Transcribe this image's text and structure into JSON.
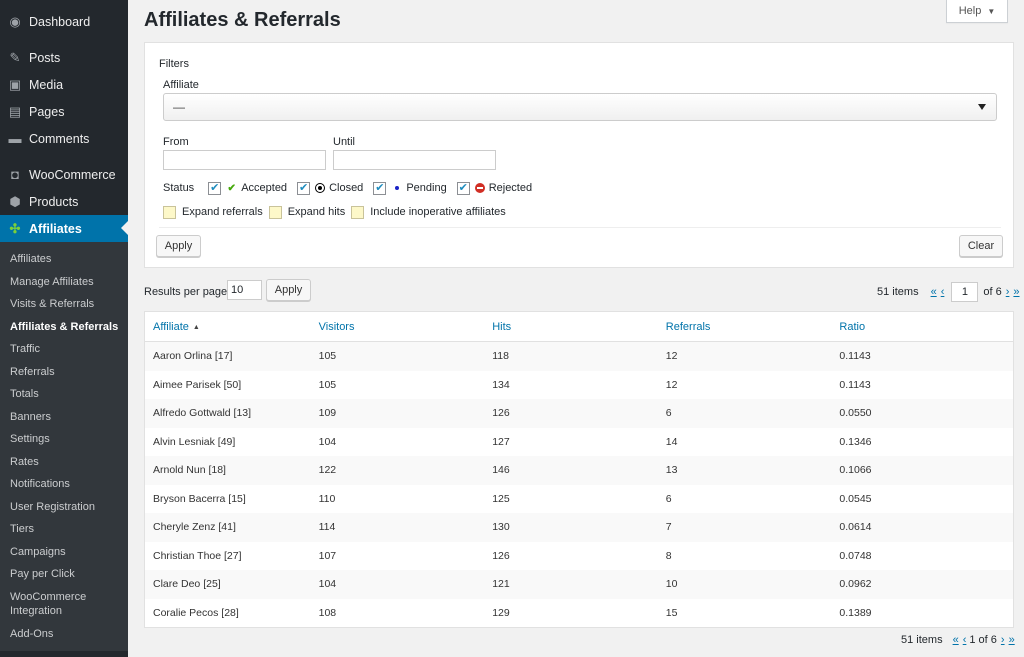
{
  "sidebar": {
    "top_items": [
      {
        "label": "Dashboard",
        "icon": "dashboard-icon"
      },
      {
        "label": "Posts",
        "icon": "pin-icon"
      },
      {
        "label": "Media",
        "icon": "media-icon"
      },
      {
        "label": "Pages",
        "icon": "pages-icon"
      },
      {
        "label": "Comments",
        "icon": "comment-icon"
      },
      {
        "label": "WooCommerce",
        "icon": "woo-icon"
      },
      {
        "label": "Products",
        "icon": "box-icon"
      },
      {
        "label": "Affiliates",
        "icon": "affiliates-icon"
      }
    ],
    "sub_items": [
      "Affiliates",
      "Manage Affiliates",
      "Visits & Referrals",
      "Affiliates & Referrals",
      "Traffic",
      "Referrals",
      "Totals",
      "Banners",
      "Settings",
      "Rates",
      "Notifications",
      "User Registration",
      "Tiers",
      "Campaigns",
      "Pay per Click",
      "WooCommerce Integration",
      "Add-Ons"
    ]
  },
  "header": {
    "title": "Affiliates & Referrals",
    "help_label": "Help",
    "help_arrow": "▼"
  },
  "filters": {
    "title": "Filters",
    "affiliate_label": "Affiliate",
    "affiliate_value": "—",
    "from_label": "From",
    "until_label": "Until",
    "from_value": "",
    "until_value": "",
    "status_label": "Status",
    "statuses": [
      {
        "label": "Accepted",
        "checked": true,
        "icon": "check-icon"
      },
      {
        "label": "Closed",
        "checked": true,
        "icon": "closed-icon"
      },
      {
        "label": "Pending",
        "checked": true,
        "icon": "pending-icon"
      },
      {
        "label": "Rejected",
        "checked": true,
        "icon": "rejected-icon"
      }
    ],
    "options": [
      "Expand referrals",
      "Expand hits",
      "Include inoperative affiliates"
    ],
    "apply_label": "Apply",
    "clear_label": "Clear"
  },
  "results": {
    "per_page_label": "Results per page",
    "per_page_value": "10",
    "apply_label": "Apply",
    "items_label": "51 items",
    "first": "«",
    "prev": "‹",
    "next": "›",
    "last": "»",
    "current_page": "1",
    "of_pages": "of 6",
    "bottom_page_text": "1 of 6"
  },
  "table": {
    "columns": [
      "Affiliate",
      "Visitors",
      "Hits",
      "Referrals",
      "Ratio"
    ],
    "sort_indicator": "▲",
    "rows": [
      [
        "Aaron Orlina [17]",
        "105",
        "118",
        "12",
        "0.1143"
      ],
      [
        "Aimee Parisek [50]",
        "105",
        "134",
        "12",
        "0.1143"
      ],
      [
        "Alfredo Gottwald [13]",
        "109",
        "126",
        "6",
        "0.0550"
      ],
      [
        "Alvin Lesniak [49]",
        "104",
        "127",
        "14",
        "0.1346"
      ],
      [
        "Arnold Nun [18]",
        "122",
        "146",
        "13",
        "0.1066"
      ],
      [
        "Bryson Bacerra [15]",
        "110",
        "125",
        "6",
        "0.0545"
      ],
      [
        "Cheryle Zenz [41]",
        "114",
        "130",
        "7",
        "0.0614"
      ],
      [
        "Christian Thoe [27]",
        "107",
        "126",
        "8",
        "0.0748"
      ],
      [
        "Clare Deo [25]",
        "104",
        "121",
        "10",
        "0.0962"
      ],
      [
        "Coralie Pecos [28]",
        "108",
        "129",
        "15",
        "0.1389"
      ]
    ]
  }
}
